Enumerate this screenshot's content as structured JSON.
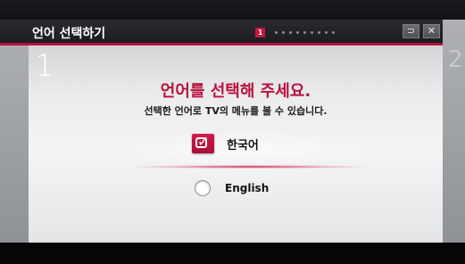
{
  "header": {
    "title": "언어 선택하기",
    "current_step": "1",
    "step_count": 10,
    "back_icon": "⊃",
    "close_icon": "✕"
  },
  "panels": {
    "current_number": "1",
    "next_number": "2"
  },
  "main": {
    "title": "언어를 선택해 주세요.",
    "subtitle": "선택한 언어로 TV의 메뉴를 볼 수 있습니다."
  },
  "options": [
    {
      "label": "한국어",
      "selected": true,
      "control": "checkbox"
    },
    {
      "label": "English",
      "selected": false,
      "control": "radio"
    }
  ],
  "colors": {
    "accent": "#b2123b",
    "header_bg": "#1e1e23",
    "panel_bg": "#ececed"
  }
}
